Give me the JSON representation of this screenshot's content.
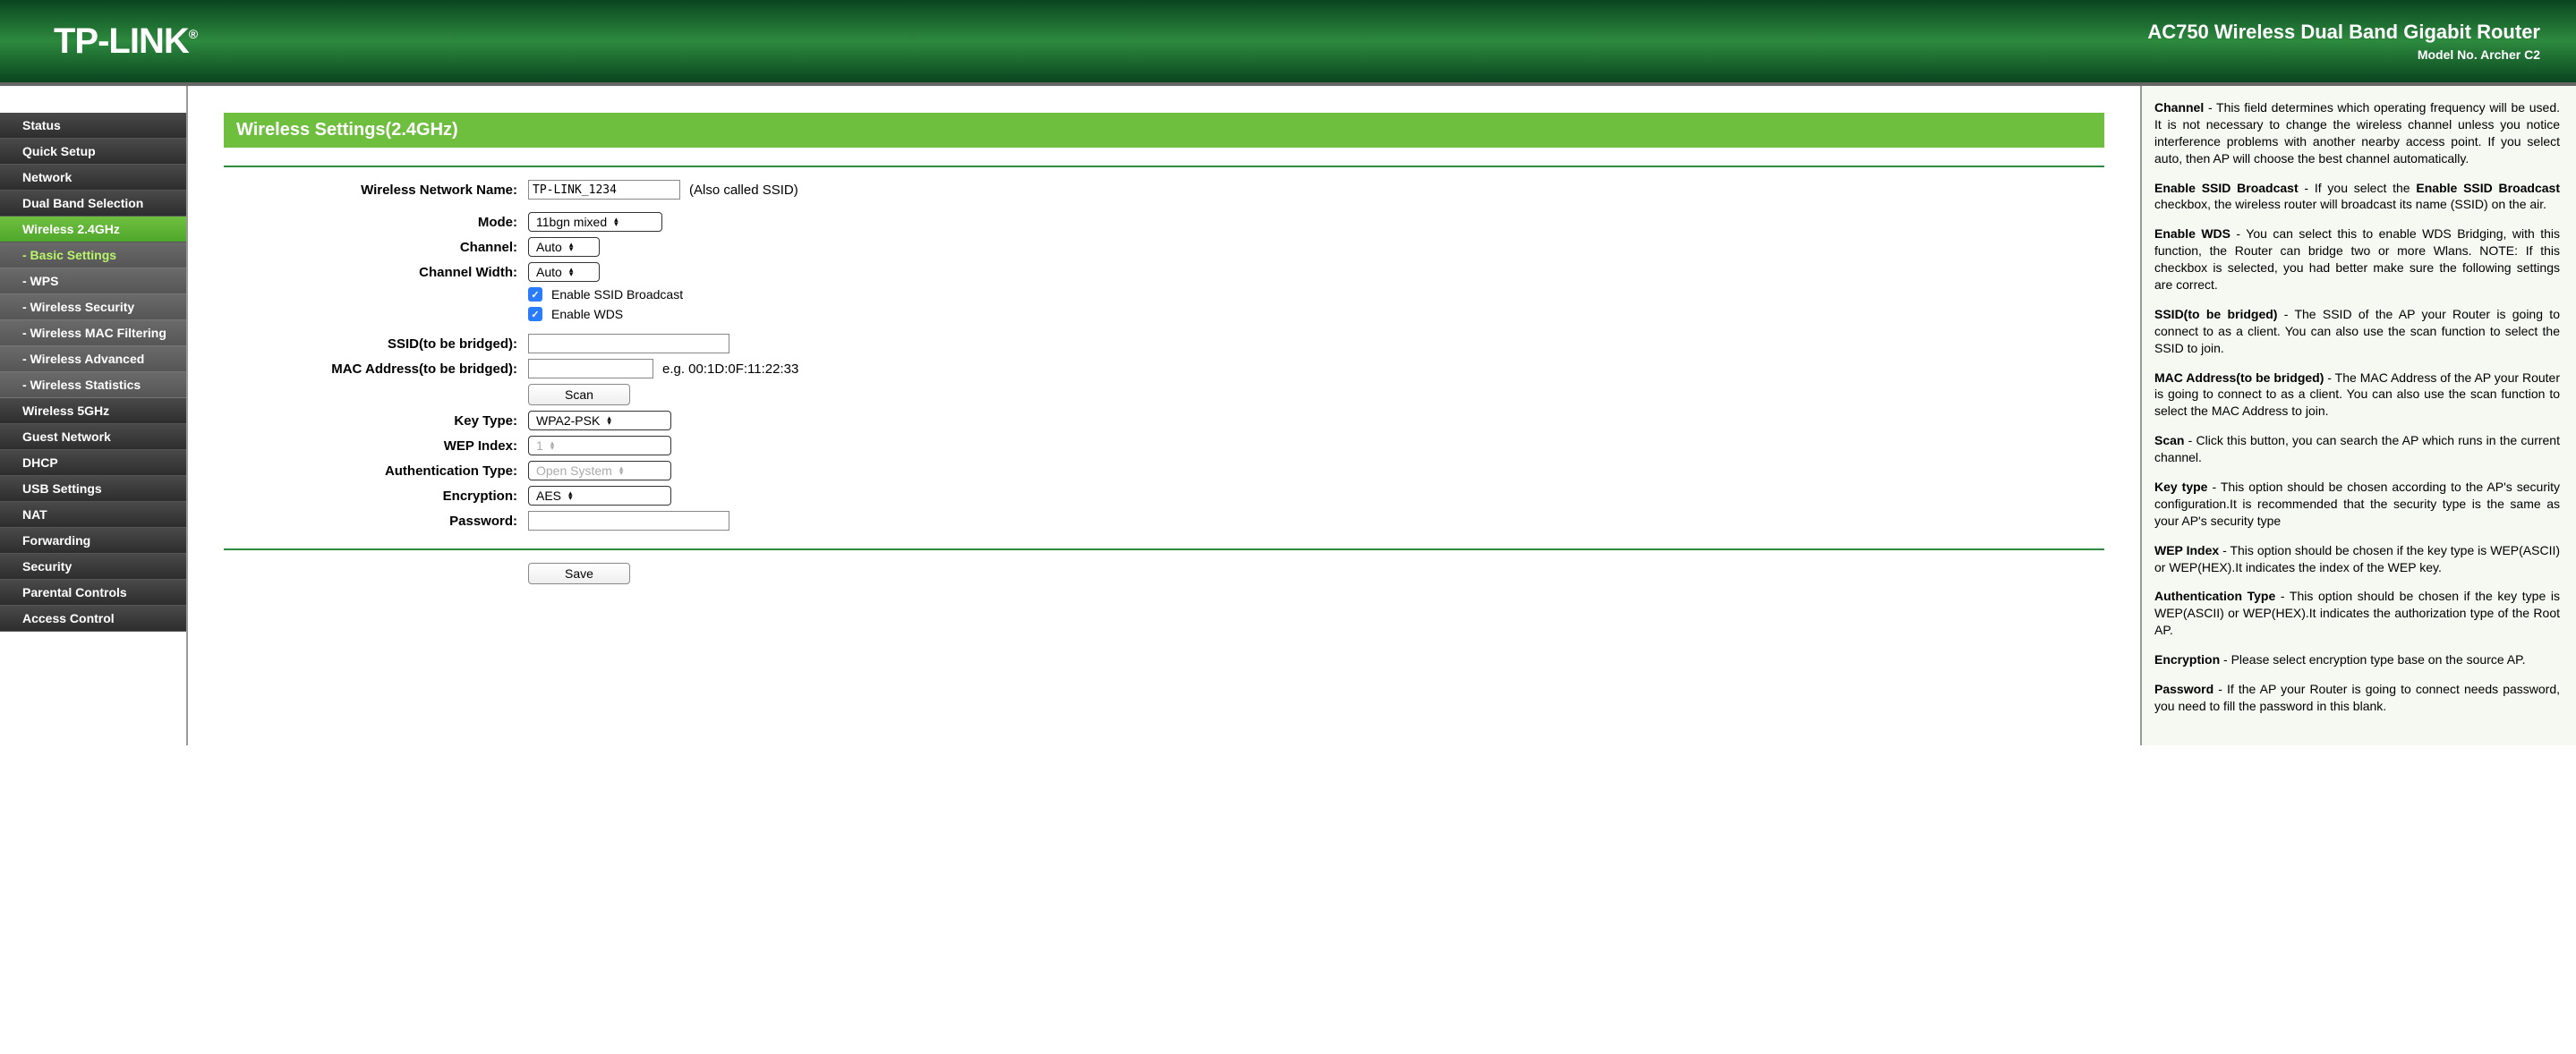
{
  "header": {
    "logo": "TP-LINK",
    "title": "AC750 Wireless Dual Band Gigabit Router",
    "model": "Model No. Archer C2"
  },
  "nav": {
    "items": [
      "Status",
      "Quick Setup",
      "Network",
      "Dual Band Selection",
      "Wireless 2.4GHz",
      "Wireless 5GHz",
      "Guest Network",
      "DHCP",
      "USB Settings",
      "NAT",
      "Forwarding",
      "Security",
      "Parental Controls",
      "Access Control"
    ],
    "sub": [
      "- Basic Settings",
      "- WPS",
      "- Wireless Security",
      "- Wireless MAC Filtering",
      "- Wireless Advanced",
      "- Wireless Statistics"
    ]
  },
  "page": {
    "title": "Wireless Settings(2.4GHz)",
    "labels": {
      "name": "Wireless Network Name:",
      "name_hint": "(Also called SSID)",
      "mode": "Mode:",
      "channel": "Channel:",
      "width": "Channel Width:",
      "ssid_broadcast": "Enable SSID Broadcast",
      "wds": "Enable WDS",
      "bridged_ssid": "SSID(to be bridged):",
      "bridged_mac": "MAC Address(to be bridged):",
      "mac_hint": "e.g. 00:1D:0F:11:22:33",
      "scan": "Scan",
      "keytype": "Key Type:",
      "wepindex": "WEP Index:",
      "authtype": "Authentication Type:",
      "encryption": "Encryption:",
      "password": "Password:",
      "save": "Save"
    },
    "values": {
      "name": "TP-LINK_1234",
      "mode": "11bgn mixed",
      "channel": "Auto",
      "width": "Auto",
      "bridged_ssid": "",
      "bridged_mac": "",
      "keytype": "WPA2-PSK",
      "wepindex": "1",
      "authtype": "Open System",
      "encryption": "AES",
      "password": ""
    }
  },
  "help": {
    "p1a": "Channel",
    "p1b": " - This field determines which operating frequency will be used. It is not necessary to change the wireless channel unless you notice interference problems with another nearby access point. If you select auto, then AP will choose the best channel automatically.",
    "p2a": "Enable SSID Broadcast",
    "p2b": " - If you select the ",
    "p2c": "Enable SSID Broadcast",
    "p2d": " checkbox, the wireless router will broadcast its name (SSID) on the air.",
    "p3a": "Enable WDS",
    "p3b": " - You can select this to enable WDS Bridging, with this function, the Router can bridge two or more Wlans. NOTE: If this checkbox is selected, you had better make sure the following settings are correct.",
    "p4a": "SSID(to be bridged)",
    "p4b": " - The SSID of the AP your Router is going to connect to as a client. You can also use the scan function to select the SSID to join.",
    "p5a": "MAC Address(to be bridged)",
    "p5b": " - The MAC Address of the AP your Router is going to connect to as a client. You can also use the scan function to select the MAC Address to join.",
    "p6a": "Scan",
    "p6b": " - Click this button, you can search the AP which runs in the current channel.",
    "p7a": "Key type",
    "p7b": " - This option should be chosen according to the AP's security configuration.It is recommended that the security type is the same as your AP's security type",
    "p8a": "WEP Index",
    "p8b": " - This option should be chosen if the key type is WEP(ASCII) or WEP(HEX).It indicates the index of the WEP key.",
    "p9a": "Authentication Type",
    "p9b": " - This option should be chosen if the key type is WEP(ASCII) or WEP(HEX).It indicates the authorization type of the Root AP.",
    "p10a": "Encryption",
    "p10b": " - Please select encryption type base on the source AP.",
    "p11a": "Password",
    "p11b": " - If the AP your Router is going to connect needs password, you need to fill the password in this blank."
  }
}
